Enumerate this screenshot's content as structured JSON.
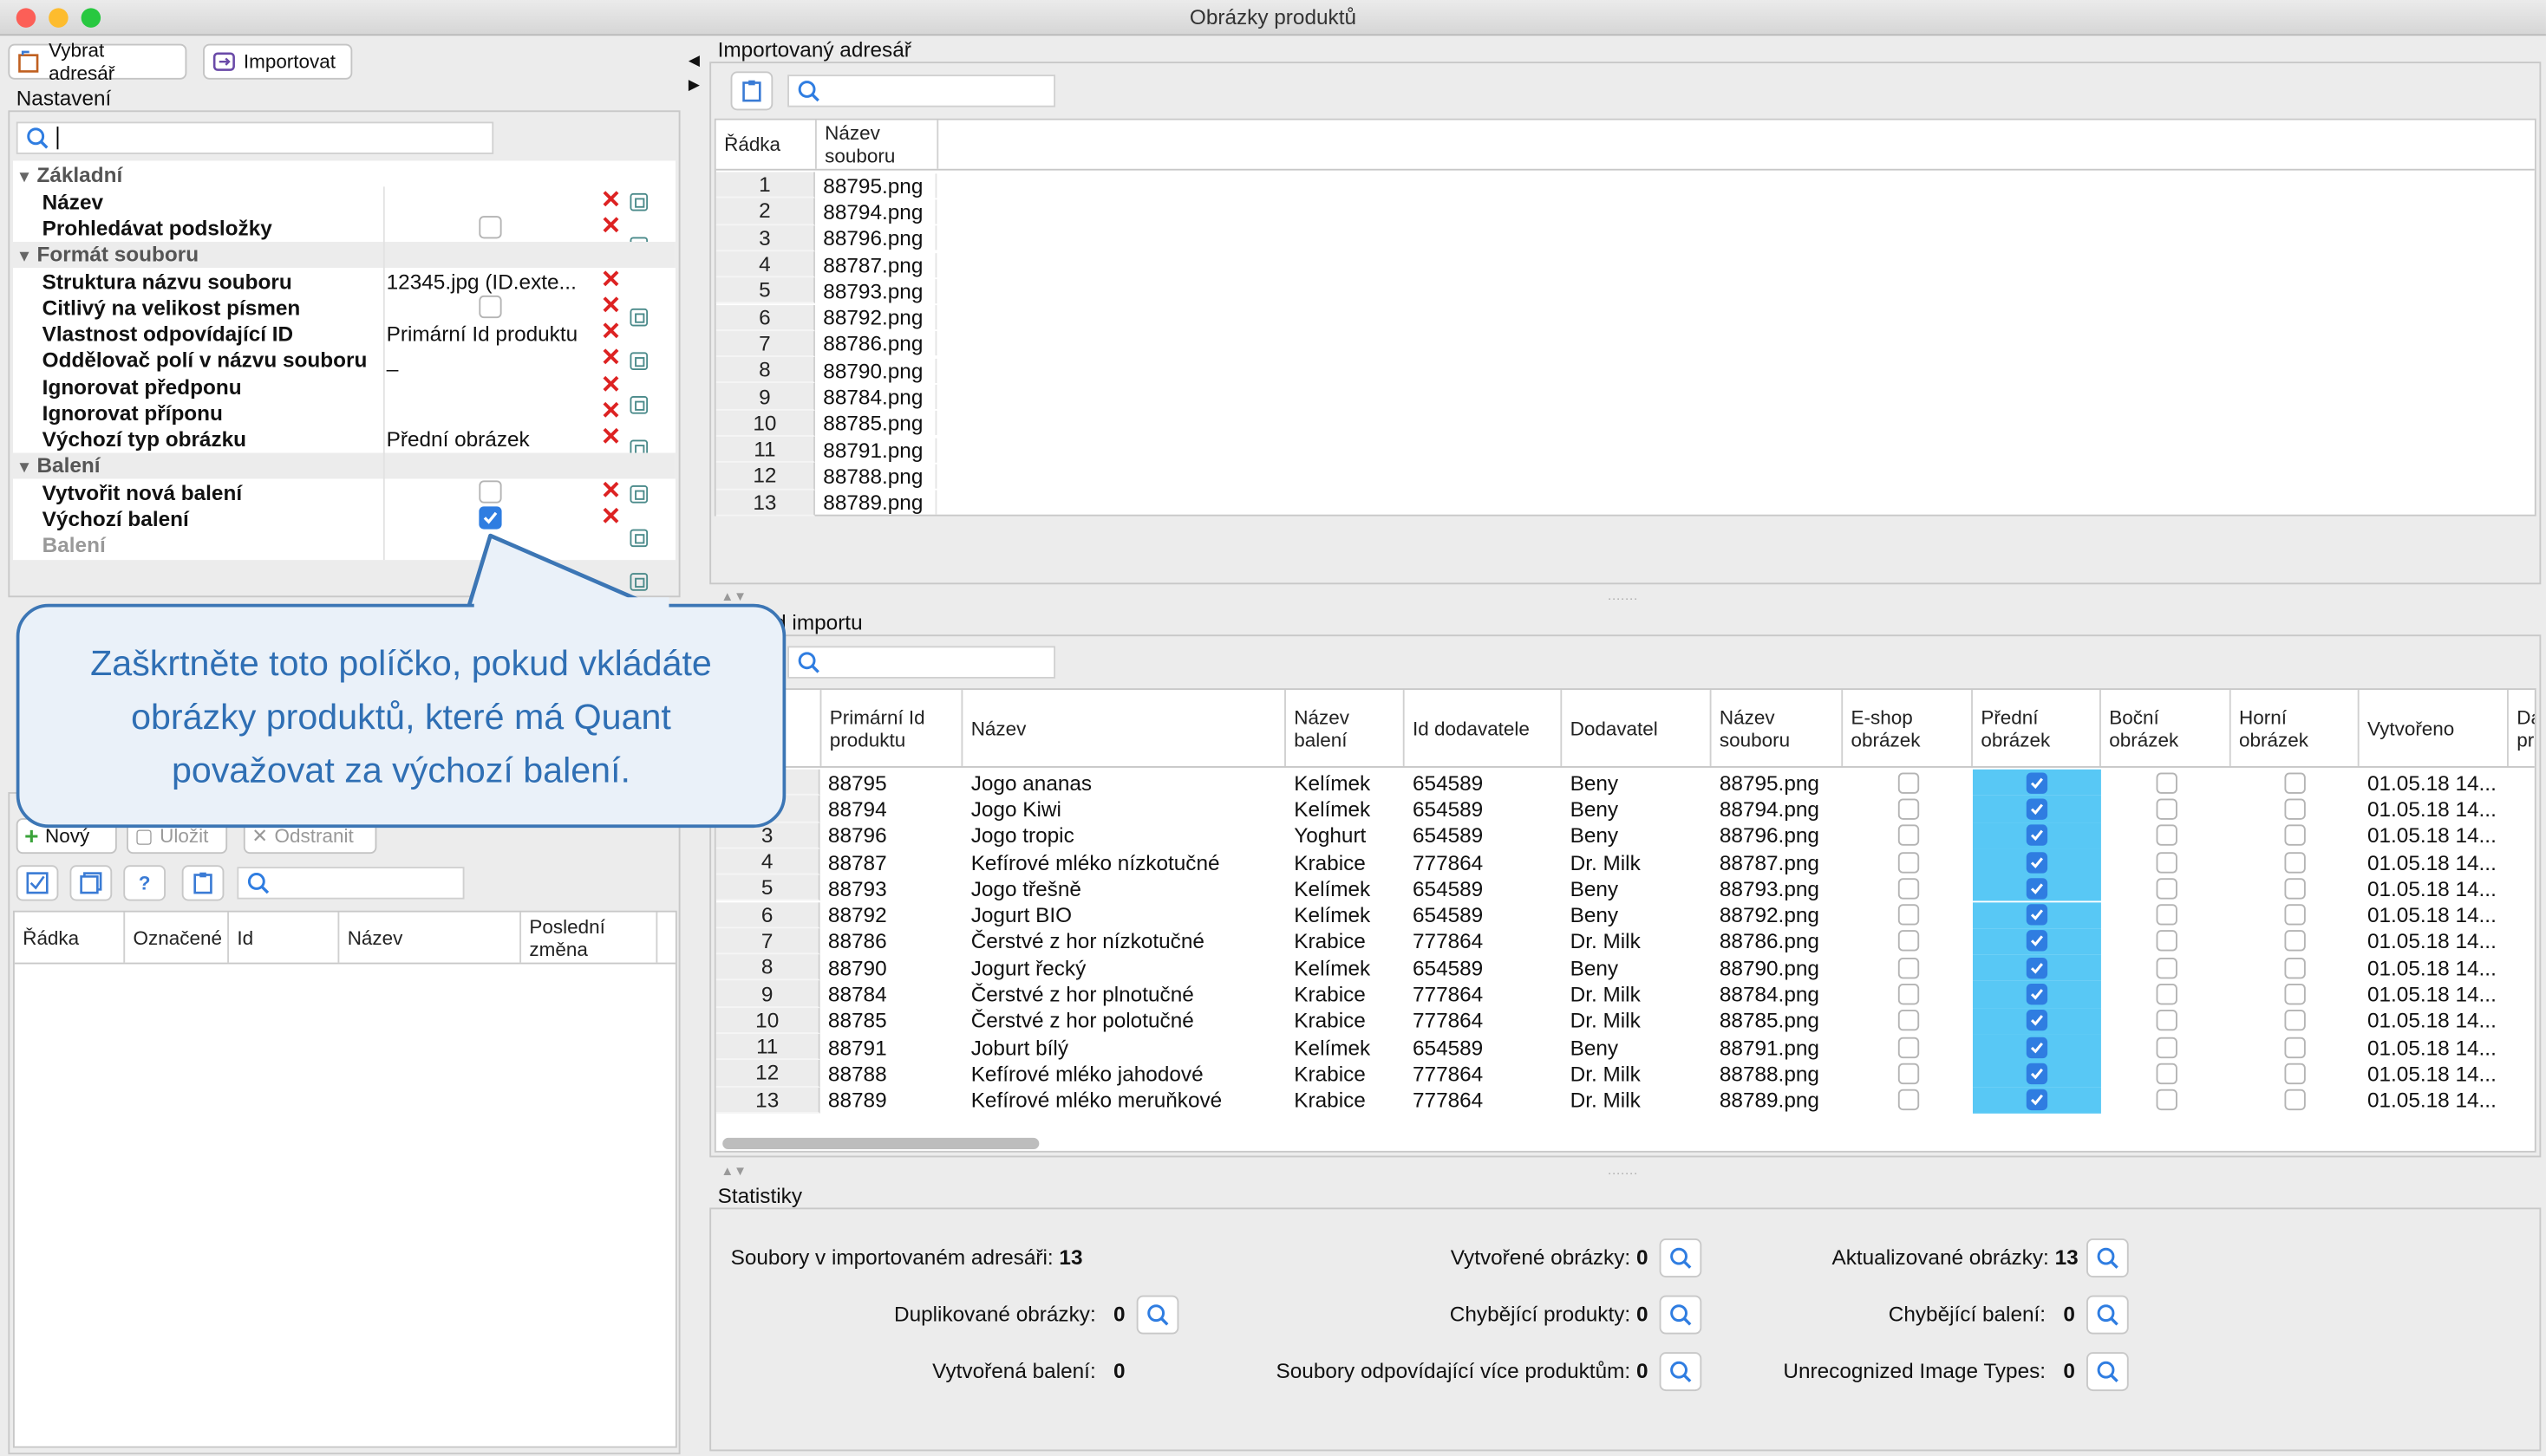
{
  "window": {
    "title": "Obrázky produktů"
  },
  "toolbar": {
    "choose_dir": "Vybrat adresář",
    "import": "Importovat"
  },
  "settings": {
    "title": "Nastavení",
    "groups": [
      {
        "label": "Základní"
      },
      {
        "label": "Formát souboru"
      },
      {
        "label": "Balení"
      }
    ],
    "props": {
      "nazev": {
        "label": "Název",
        "value": ""
      },
      "podslozky": {
        "label": "Prohledávat podsložky",
        "checked": false
      },
      "struktura": {
        "label": "Struktura názvu souboru",
        "value": "12345.jpg (ID.exte..."
      },
      "citlivy": {
        "label": "Citlivý na velikost písmen",
        "checked": false
      },
      "vlastnost": {
        "label": "Vlastnost odpovídající ID",
        "value": "Primární Id produktu"
      },
      "oddelovac": {
        "label": "Oddělovač polí v názvu souboru",
        "value": "_"
      },
      "predpona": {
        "label": "Ignorovat předponu",
        "value": ""
      },
      "pripona": {
        "label": "Ignorovat příponu",
        "value": ""
      },
      "typ": {
        "label": "Výchozí typ obrázku",
        "value": "Přední obrázek"
      },
      "nova": {
        "label": "Vytvořit nová balení",
        "checked": false
      },
      "vychozi": {
        "label": "Výchozí balení",
        "checked": true
      },
      "baleni": {
        "label": "Balení",
        "value": ""
      }
    }
  },
  "callout": {
    "text": "Zaškrtněte toto políčko, pokud vkládáte obrázky produktů, které má Quant považovat za výchozí balení."
  },
  "packaging": {
    "new_label": "Nový",
    "save_label": "Uložit",
    "delete_label": "Odstranit",
    "columns": [
      "Řádka",
      "Označené",
      "Id",
      "Název",
      "Poslední změna"
    ]
  },
  "imported_dir": {
    "title": "Importovaný adresář",
    "columns": [
      "Řádka",
      "Název souboru"
    ],
    "rows": [
      [
        "1",
        "88795.png"
      ],
      [
        "2",
        "88794.png"
      ],
      [
        "3",
        "88796.png"
      ],
      [
        "4",
        "88787.png"
      ],
      [
        "5",
        "88793.png"
      ],
      [
        "6",
        "88792.png"
      ],
      [
        "7",
        "88786.png"
      ],
      [
        "8",
        "88790.png"
      ],
      [
        "9",
        "88784.png"
      ],
      [
        "10",
        "88785.png"
      ],
      [
        "11",
        "88791.png"
      ],
      [
        "12",
        "88788.png"
      ],
      [
        "13",
        "88789.png"
      ]
    ]
  },
  "import_preview": {
    "title": "d importu",
    "columns": [
      "Primární Id produktu",
      "Název",
      "Název balení",
      "Id dodavatele",
      "Dodavatel",
      "Název souboru",
      "E-shop obrázek",
      "Přední obrázek",
      "Boční obrázek",
      "Horní obrázek",
      "Vytvořeno",
      "Da pr"
    ],
    "rows": [
      {
        "n": "",
        "id": "88795",
        "name": "Jogo ananas",
        "pack": "Kelímek",
        "sup_id": "654589",
        "sup": "Beny",
        "file": "88795.png",
        "created": "01.05.18 14..."
      },
      {
        "n": "",
        "id": "88794",
        "name": "Jogo Kiwi",
        "pack": "Kelímek",
        "sup_id": "654589",
        "sup": "Beny",
        "file": "88794.png",
        "created": "01.05.18 14..."
      },
      {
        "n": "3",
        "id": "88796",
        "name": "Jogo tropic",
        "pack": "Yoghurt",
        "sup_id": "654589",
        "sup": "Beny",
        "file": "88796.png",
        "created": "01.05.18 14..."
      },
      {
        "n": "4",
        "id": "88787",
        "name": "Kefírové mléko nízkotučné",
        "pack": "Krabice",
        "sup_id": "777864",
        "sup": "Dr. Milk",
        "file": "88787.png",
        "created": "01.05.18 14..."
      },
      {
        "n": "5",
        "id": "88793",
        "name": "Jogo třešně",
        "pack": "Kelímek",
        "sup_id": "654589",
        "sup": "Beny",
        "file": "88793.png",
        "created": "01.05.18 14..."
      },
      {
        "n": "6",
        "id": "88792",
        "name": "Jogurt BIO",
        "pack": "Kelímek",
        "sup_id": "654589",
        "sup": "Beny",
        "file": "88792.png",
        "created": "01.05.18 14..."
      },
      {
        "n": "7",
        "id": "88786",
        "name": "Čerstvé z hor nízkotučné",
        "pack": "Krabice",
        "sup_id": "777864",
        "sup": "Dr. Milk",
        "file": "88786.png",
        "created": "01.05.18 14..."
      },
      {
        "n": "8",
        "id": "88790",
        "name": "Jogurt řecký",
        "pack": "Kelímek",
        "sup_id": "654589",
        "sup": "Beny",
        "file": "88790.png",
        "created": "01.05.18 14..."
      },
      {
        "n": "9",
        "id": "88784",
        "name": "Čerstvé z hor plnotučné",
        "pack": "Krabice",
        "sup_id": "777864",
        "sup": "Dr. Milk",
        "file": "88784.png",
        "created": "01.05.18 14..."
      },
      {
        "n": "10",
        "id": "88785",
        "name": "Čerstvé z hor polotučné",
        "pack": "Krabice",
        "sup_id": "777864",
        "sup": "Dr. Milk",
        "file": "88785.png",
        "created": "01.05.18 14..."
      },
      {
        "n": "11",
        "id": "88791",
        "name": "Joburt bílý",
        "pack": "Kelímek",
        "sup_id": "654589",
        "sup": "Beny",
        "file": "88791.png",
        "created": "01.05.18 14..."
      },
      {
        "n": "12",
        "id": "88788",
        "name": "Kefírové mléko jahodové",
        "pack": "Krabice",
        "sup_id": "777864",
        "sup": "Dr. Milk",
        "file": "88788.png",
        "created": "01.05.18 14..."
      },
      {
        "n": "13",
        "id": "88789",
        "name": "Kefírové mléko meruňkové",
        "pack": "Krabice",
        "sup_id": "777864",
        "sup": "Dr. Milk",
        "file": "88789.png",
        "created": "01.05.18 14..."
      }
    ]
  },
  "stats": {
    "title": "Statistiky",
    "files_label": "Soubory v importovaném adresáři:",
    "files": "13",
    "created_label": "Vytvořené obrázky:",
    "created": "0",
    "updated_label": "Aktualizované obrázky:",
    "updated": "13",
    "dup_label": "Duplikované obrázky:",
    "dup": "0",
    "missing_prod_label": "Chybějící produkty:",
    "missing_prod": "0",
    "missing_pack_label": "Chybějící balení:",
    "missing_pack": "0",
    "packs_label": "Vytvořená balení:",
    "packs": "0",
    "multi_label": "Soubory odpovídající více produktům:",
    "multi": "0",
    "unrec_label": "Unrecognized Image Types:",
    "unrec": "0"
  },
  "colors": {
    "selection": "#58c8f5",
    "accent": "#2f7de1",
    "callout_border": "#3c76b5",
    "callout_text": "#2f6fb4"
  }
}
